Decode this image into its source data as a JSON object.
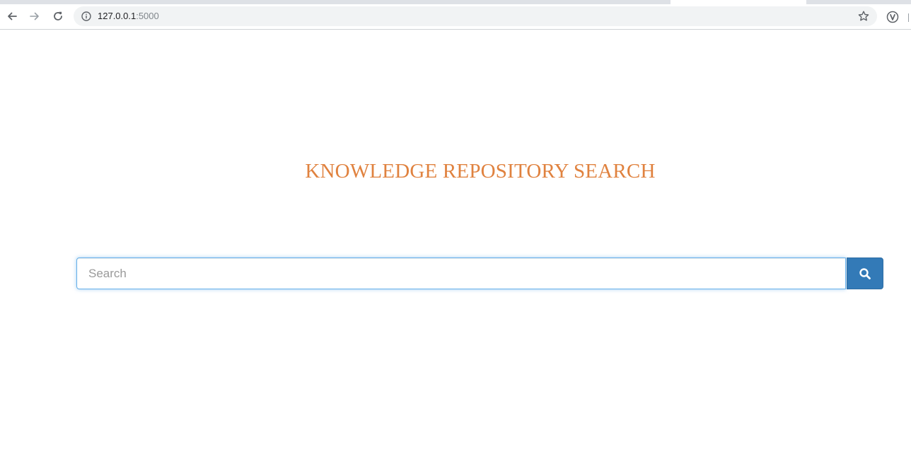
{
  "browser": {
    "url_host": "127.0.0.1",
    "url_port": ":5000",
    "icons": {
      "back": "arrow-left-icon",
      "forward": "arrow-right-icon",
      "reload": "reload-icon",
      "site_info": "info-icon",
      "bookmark": "star-icon",
      "extension": "v-extension-icon"
    }
  },
  "page": {
    "title": "KNOWLEDGE REPOSITORY SEARCH",
    "title_color": "#e0823f"
  },
  "search": {
    "value": "",
    "placeholder": "Search",
    "button_icon": "search-icon",
    "button_color": "#337ab7"
  }
}
